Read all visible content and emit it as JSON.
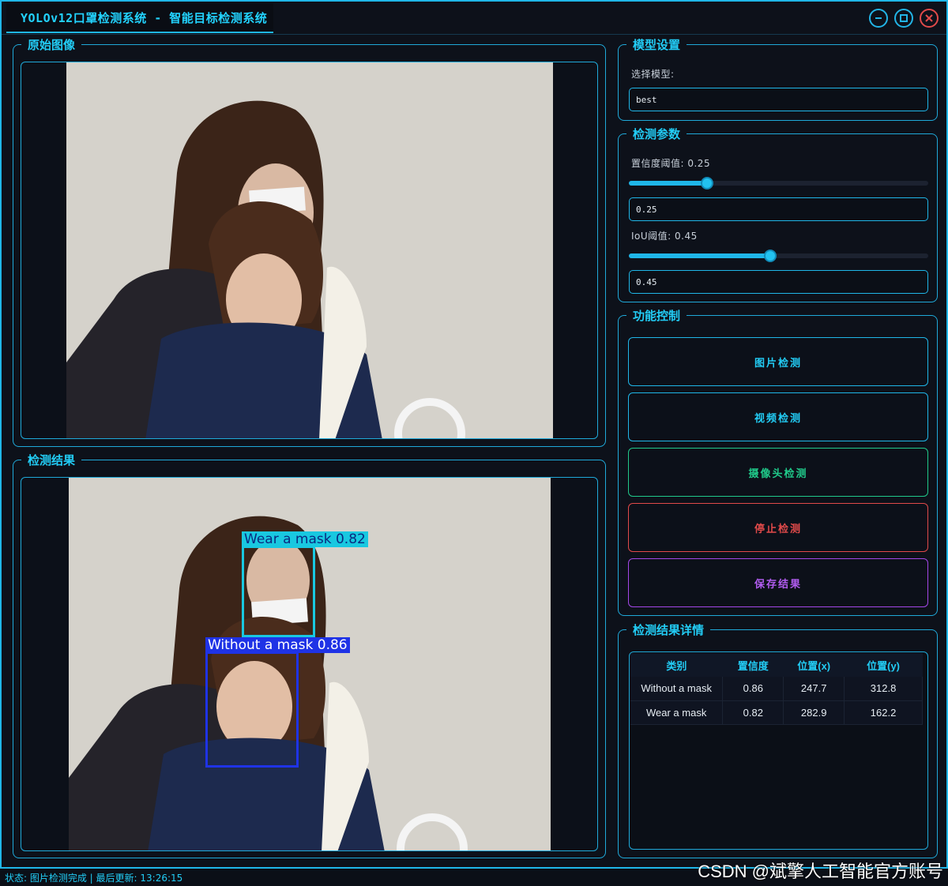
{
  "window": {
    "title": "YOLOv12口罩检测系统 - 智能目标检测系统"
  },
  "panels": {
    "original": {
      "title": "原始图像"
    },
    "result": {
      "title": "检测结果"
    }
  },
  "detections": [
    {
      "label": "Wear a mask 0.82",
      "color": "#19c8e0"
    },
    {
      "label": "Without a mask 0.86",
      "color": "#1f33e6"
    }
  ],
  "model_settings": {
    "title": "模型设置",
    "select_label": "选择模型:",
    "selected_model": "best"
  },
  "params": {
    "title": "检测参数",
    "confidence_label": "置信度阈值: 0.25",
    "confidence_value": "0.25",
    "confidence_fraction": 0.25,
    "iou_label": "IoU阈值: 0.45",
    "iou_value": "0.45",
    "iou_fraction": 0.45
  },
  "controls": {
    "title": "功能控制",
    "image_detect": "图片检测",
    "video_detect": "视频检测",
    "camera_detect": "摄像头检测",
    "stop_detect": "停止检测",
    "save_result": "保存结果"
  },
  "results": {
    "title": "检测结果详情",
    "columns": [
      "类别",
      "置信度",
      "位置(x)",
      "位置(y)"
    ],
    "rows": [
      [
        "Without a mask",
        "0.86",
        "247.7",
        "312.8"
      ],
      [
        "Wear a mask",
        "0.82",
        "282.9",
        "162.2"
      ]
    ]
  },
  "status": {
    "text": "状态: 图片检测完成 | 最后更新: 13:26:15"
  },
  "watermark": "CSDN @斌擎人工智能官方账号",
  "colors": {
    "accent": "#1fb6e8",
    "camera": "#20c98a",
    "stop": "#e14a4a",
    "save": "#a347e8"
  }
}
